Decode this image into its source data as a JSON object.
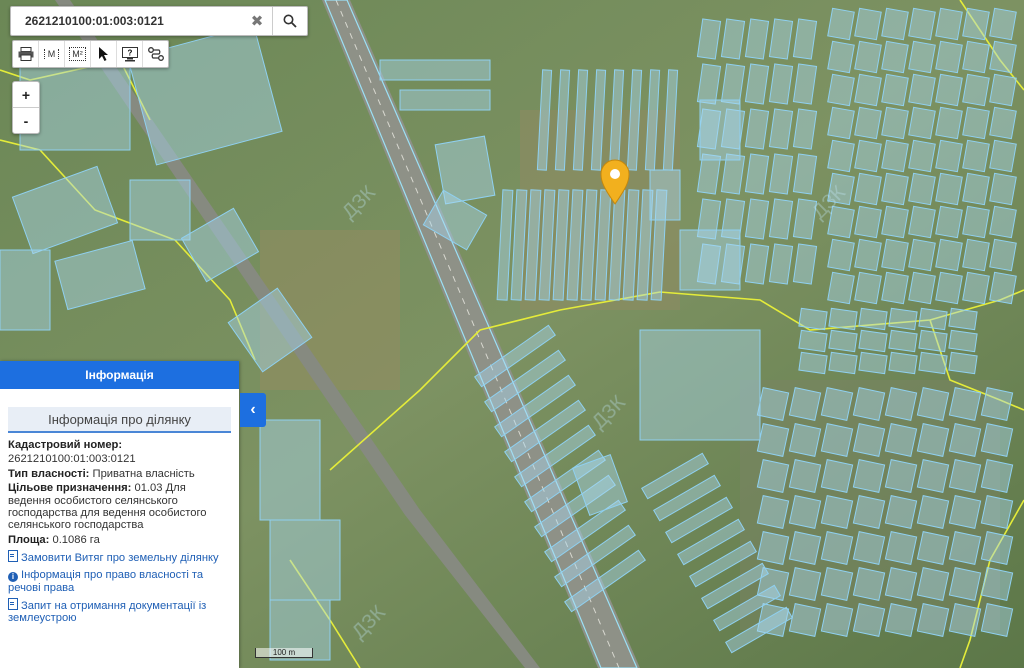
{
  "search": {
    "value": "2621210100:01:003:0121"
  },
  "toolbar": {
    "measure_label": "M",
    "area_label": "M²"
  },
  "zoom": {
    "in": "+",
    "out": "-"
  },
  "panel": {
    "title": "Інформація",
    "subtitle": "Інформація про ділянку",
    "cadastral_label": "Кадастровий номер:",
    "cadastral_value": "2621210100:01:003:0121",
    "ownership_label": "Тип власності:",
    "ownership_value": "Приватна власність",
    "purpose_label": "Цільове призначення:",
    "purpose_value": "01.03 Для ведення особистого селянського господарства для ведення особистого селянського господарства",
    "area_label": "Площа:",
    "area_value": "0.1086 га",
    "links": [
      "Замовити Витяг про земельну ділянку",
      "Інформація про право власності та речові права",
      "Запит на отримання документації із землеустрою"
    ]
  },
  "scale": {
    "label": "100 m"
  },
  "colors": {
    "accent": "#1d6fe0",
    "parcel_fill": "#a9d6ee",
    "parcel_stroke": "#8fd0f0",
    "boundary": "#e4ec3a",
    "marker": "#f2b01e"
  }
}
